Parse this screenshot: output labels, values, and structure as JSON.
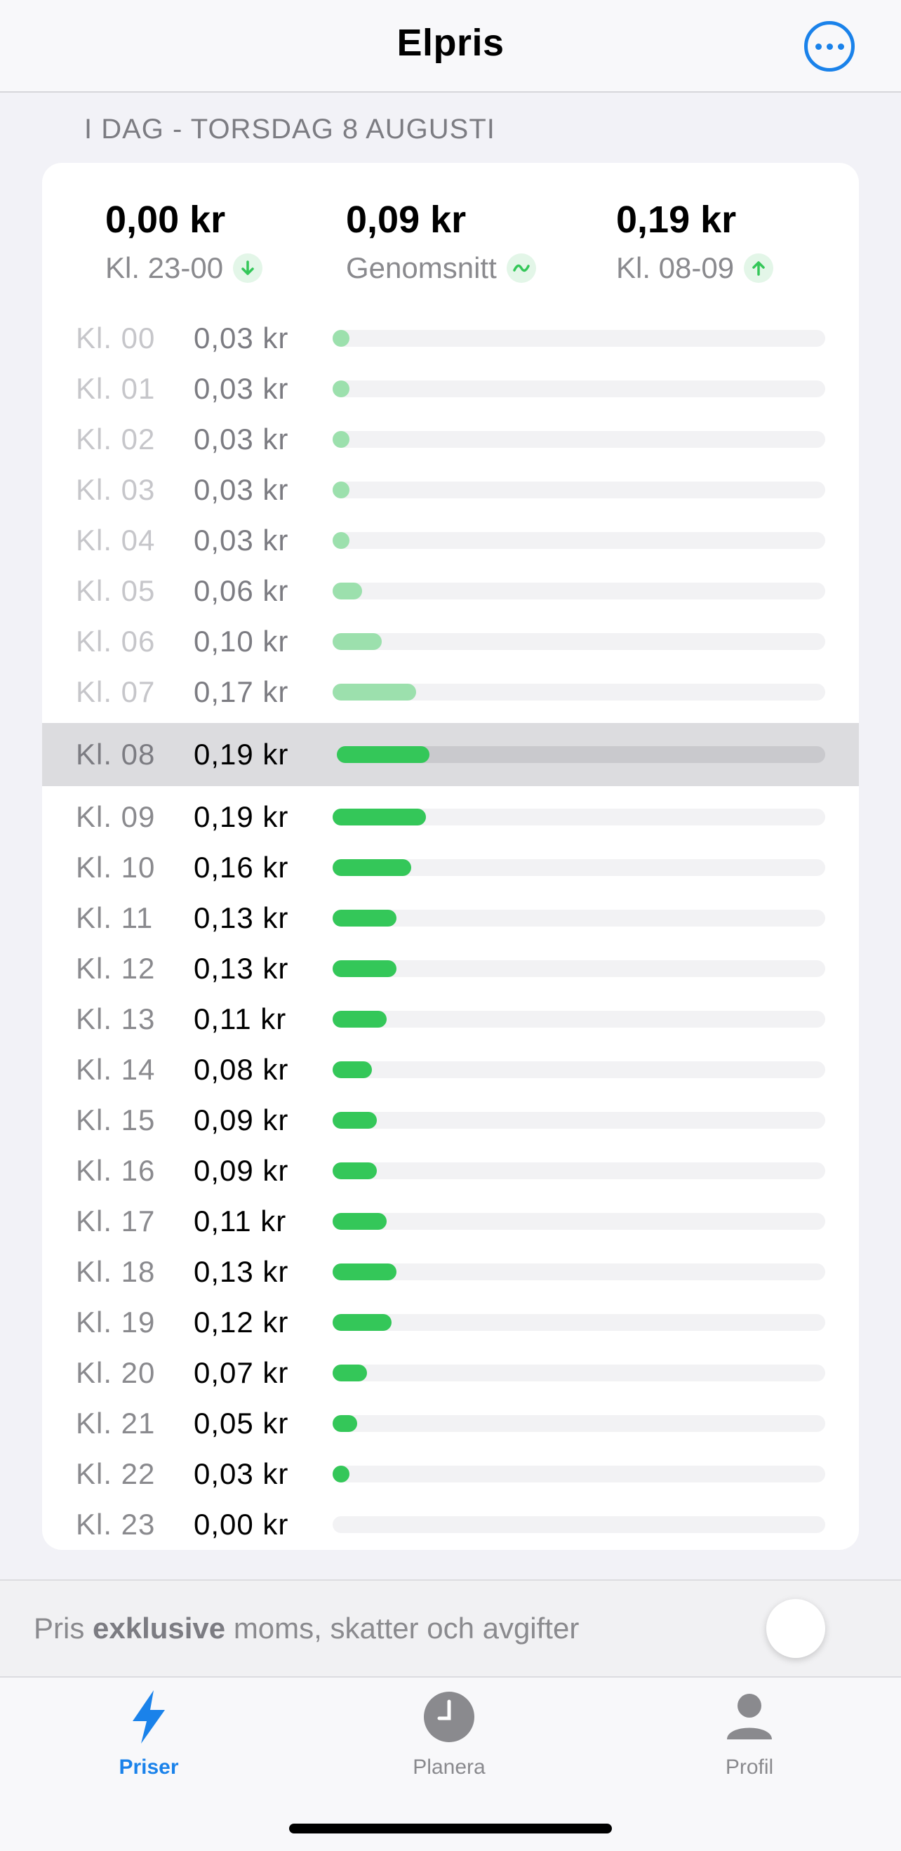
{
  "nav": {
    "title": "Elpris"
  },
  "section_header": "I DAG - TORSDAG 8 AUGUSTI",
  "summary": [
    {
      "value": "0,00 kr",
      "label": "Kl. 23-00",
      "icon": "arrow-down-icon"
    },
    {
      "value": "0,09 kr",
      "label": "Genomsnitt",
      "icon": "trend-icon"
    },
    {
      "value": "0,19 kr",
      "label": "Kl. 08-09",
      "icon": "arrow-up-icon"
    }
  ],
  "chart_data": {
    "type": "bar",
    "categories": [
      "Kl. 00",
      "Kl. 01",
      "Kl. 02",
      "Kl. 03",
      "Kl. 04",
      "Kl. 05",
      "Kl. 06",
      "Kl. 07",
      "Kl. 08",
      "Kl. 09",
      "Kl. 10",
      "Kl. 11",
      "Kl. 12",
      "Kl. 13",
      "Kl. 14",
      "Kl. 15",
      "Kl. 16",
      "Kl. 17",
      "Kl. 18",
      "Kl. 19",
      "Kl. 20",
      "Kl. 21",
      "Kl. 22",
      "Kl. 23"
    ],
    "labels": [
      "0,03 kr",
      "0,03 kr",
      "0,03 kr",
      "0,03 kr",
      "0,03 kr",
      "0,06 kr",
      "0,10 kr",
      "0,17 kr",
      "0,19 kr",
      "0,19 kr",
      "0,16 kr",
      "0,13 kr",
      "0,13 kr",
      "0,11 kr",
      "0,08 kr",
      "0,09 kr",
      "0,09 kr",
      "0,11 kr",
      "0,13 kr",
      "0,12 kr",
      "0,07 kr",
      "0,05 kr",
      "0,03 kr",
      "0,00 kr"
    ],
    "values": [
      0.03,
      0.03,
      0.03,
      0.03,
      0.03,
      0.06,
      0.1,
      0.17,
      0.19,
      0.19,
      0.16,
      0.13,
      0.13,
      0.11,
      0.08,
      0.09,
      0.09,
      0.11,
      0.13,
      0.12,
      0.07,
      0.05,
      0.03,
      0.0
    ],
    "xlim": [
      0,
      1.0
    ],
    "current_hour_index": 8,
    "colors": {
      "bar": "#34c759",
      "bar_past": "#9ce0ad",
      "track": "#f2f2f4"
    }
  },
  "footer": {
    "text_before": "Pris ",
    "text_bold": "exklusive",
    "text_after": " moms, skatter och avgifter"
  },
  "tabs": [
    {
      "label": "Priser",
      "icon": "bolt-icon",
      "active": true
    },
    {
      "label": "Planera",
      "icon": "clock-icon",
      "active": false
    },
    {
      "label": "Profil",
      "icon": "person-icon",
      "active": false
    }
  ],
  "colors": {
    "accent": "#1a82ea",
    "green": "#34c759"
  }
}
